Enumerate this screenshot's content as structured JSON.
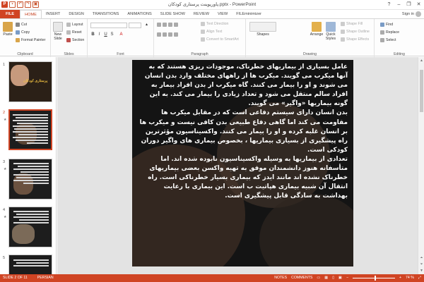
{
  "window": {
    "title": "پاورپوینت پرستاری کودکان.pptx - PowerPoint",
    "controls": [
      "?",
      "–",
      "❐",
      "✕"
    ]
  },
  "qat": {
    "app_letter": "P",
    "save": "▪",
    "undo": "↶",
    "redo": "↷",
    "start": "▣"
  },
  "tabs": [
    {
      "label": "FILE"
    },
    {
      "label": "HOME"
    },
    {
      "label": "INSERT"
    },
    {
      "label": "DESIGN"
    },
    {
      "label": "TRANSITIONS"
    },
    {
      "label": "ANIMATIONS"
    },
    {
      "label": "SLIDE SHOW"
    },
    {
      "label": "REVIEW"
    },
    {
      "label": "VIEW"
    },
    {
      "label": "FILEminimizer"
    }
  ],
  "account": {
    "sign_in": "Sign in"
  },
  "ribbon": {
    "clipboard": {
      "label": "Clipboard",
      "paste": "Paste",
      "cut": "Cut",
      "copy": "Copy",
      "format_painter": "Format Painter"
    },
    "slides": {
      "label": "Slides",
      "new_slide_1": "New",
      "new_slide_2": "Slide",
      "layout": "Layout",
      "reset": "Reset",
      "section": "Section"
    },
    "font": {
      "label": "Font",
      "bold": "B",
      "italic": "I",
      "underline": "U",
      "strike": "S",
      "font_color": "A"
    },
    "paragraph": {
      "label": "Paragraph",
      "text_direction": "Text Direction",
      "align_text": "Align Text",
      "convert_smartart": "Convert to SmartArt"
    },
    "drawing": {
      "label": "Drawing",
      "shapes": "Shapes",
      "arrange": "Arrange",
      "quick_styles_1": "Quick",
      "quick_styles_2": "Styles",
      "shape_fill": "Shape Fill",
      "shape_outline": "Shape Outline",
      "shape_effects": "Shape Effects"
    },
    "editing": {
      "label": "Editing",
      "find": "Find",
      "replace": "Replace",
      "select": "Select"
    }
  },
  "thumbnails": [
    {
      "number": "1",
      "title": "پرستاری کودکان",
      "selected": false,
      "has_star": false
    },
    {
      "number": "2",
      "selected": true,
      "has_star": true
    },
    {
      "number": "3",
      "selected": false,
      "has_star": true
    },
    {
      "number": "4",
      "selected": false,
      "has_star": true
    },
    {
      "number": "5",
      "selected": false,
      "has_star": false
    }
  ],
  "slide": {
    "paragraphs": [
      "عامل بسیاری از بیماریهای خطرناک، موجودات ریزی هستند که به آنها میکرب می گویند. میکرب ها از راههای مختلف وارد بدن انسان می شوند و او را بیمار می کنند. گاه میکرب از بدن افراد بیمار به افراد سالم منتقل می شود و تعداد زیادی را بیمار می کند. به این گونه بیماریها «واگیر» می گویند.",
      "بدن انسان دارای سیستم دفاعی است که در مقابل میکرب ها مقاومت می کند اما گاهی دفاع طبیعی بدن کافی نیست و میکرب ها بر انسان غلبه کرده و او را بیمار می کنند. واکسیناسیون مؤثرترین راه پیشگیری از بسیاری بیماریها ، بخصوص بیماری های واگیر دوران کودکی است.",
      "تعدادی از بیماریها به وسیله واکسیناسیون نابوده شده اند. اما متأسفانه هنوز دانشمندان موفق به تهیه واکسن بعضی بیماریهای خطرناک نشده اند مانند ایدز که بیماری بسیار خطرناکی است. راه انتقال آن شبیه بیماری هپاتیت ب است. این بیماری با رعایت بهداشت به سادگی قابل پیشگیری است."
    ]
  },
  "status": {
    "slide_of": "SLIDE 2 OF 11",
    "language": "PERSIAN",
    "notes": "NOTES",
    "comments": "COMMENTS",
    "zoom": "74 %",
    "zoom_fraction": 0.52
  },
  "colors": {
    "accent": "#d04423",
    "slide_bg": "#141414",
    "slide_text": "#ffffff"
  }
}
